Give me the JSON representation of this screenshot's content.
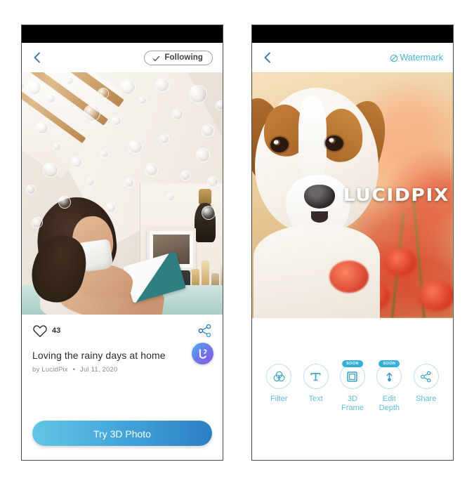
{
  "theme": {
    "accent_blue": "#49b5cf",
    "tool_blue": "#62bdd6",
    "soon_badge_bg": "#35aede",
    "cta_gradient_from": "#63c6e4",
    "cta_gradient_to": "#2e7fc4",
    "statusbar": "#000000",
    "page_bg": "#ffffff"
  },
  "feed_screen": {
    "nav": {
      "back_icon": "chevron-left-icon",
      "follow_button": {
        "label": "Following",
        "icon": "check-icon"
      }
    },
    "photo": {
      "alt": "Woman in bathrobe drinking from a mug while reading a book in a bright attic room with soap bubbles floating"
    },
    "post": {
      "like_icon": "heart-outline-icon",
      "like_count": "43",
      "share_icon": "share-nodes-icon",
      "caption": "Loving the rainy days at home",
      "author_prefix": "by",
      "author": "LucidPix",
      "separator": "•",
      "date": "Jul 11, 2020",
      "avatar_icon": "lucidpix-logo-icon"
    },
    "cta_button": "Try 3D Photo"
  },
  "editor_screen": {
    "nav": {
      "back_icon": "chevron-left-icon",
      "watermark_button": {
        "label": "Watermark",
        "icon": "no-watermark-icon"
      }
    },
    "photo": {
      "alt": "Close-up portrait of a brown and white dog in a field of red poppies",
      "watermark_text": "LUCIDPIX"
    },
    "tools": [
      {
        "label": "Filter",
        "icon": "filter-rings-icon",
        "badge": ""
      },
      {
        "label": "Text",
        "icon": "text-tool-icon",
        "badge": ""
      },
      {
        "label": "3D\nFrame",
        "label_line1": "3D",
        "label_line2": "Frame",
        "icon": "frame-icon",
        "badge": "SOON"
      },
      {
        "label": "Edit\nDepth",
        "label_line1": "Edit",
        "label_line2": "Depth",
        "icon": "depth-arrow-icon",
        "badge": "SOON"
      },
      {
        "label": "Share",
        "icon": "share-nodes-icon",
        "badge": ""
      }
    ]
  }
}
